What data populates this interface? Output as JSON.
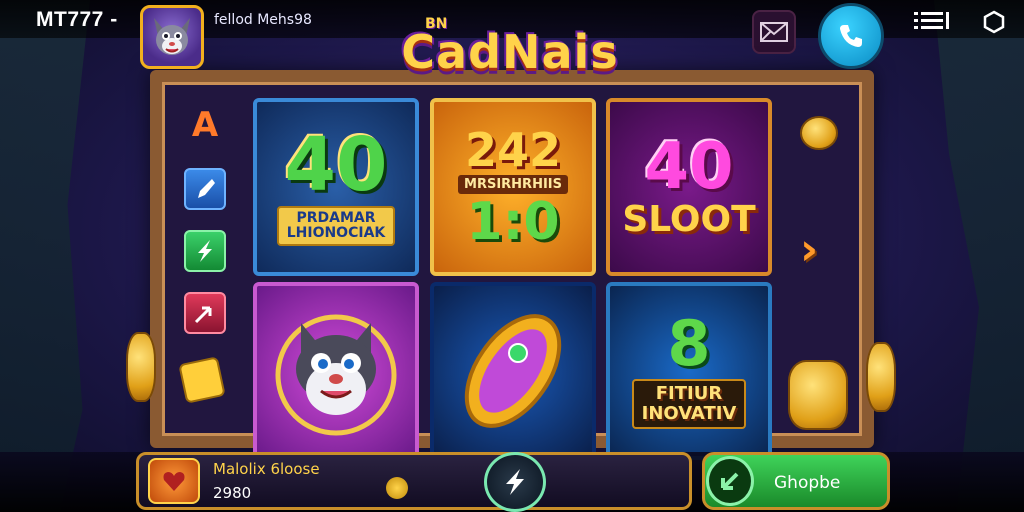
{
  "header": {
    "brand": "MT777 -",
    "subtitle": "fellod Mehs98",
    "mail_icon": "mail-icon",
    "phone_icon": "phone-icon",
    "menu_icon": "menu-icon",
    "settings_icon": "settings-icon"
  },
  "logo": {
    "small": "BN",
    "title": "CadNais"
  },
  "side_left": {
    "letter": "A"
  },
  "reels": {
    "r1": {
      "number": "40",
      "banner_line1": "PRDAMAR",
      "banner_line2": "LHIONOCIAK"
    },
    "r2": {
      "number_a": "242",
      "label": "MRSIRHRHIIS",
      "number_b": "1:0"
    },
    "r3": {
      "number": "40",
      "word": "SLOOT"
    },
    "r6": {
      "number": "8",
      "line1": "FITIUR",
      "line2": "INOVATIV"
    }
  },
  "bottom": {
    "info_title": "Malolix 6loose",
    "info_value": "2980",
    "action_label": "Ghopbe"
  },
  "colors": {
    "accent_gold": "#ffd34a",
    "accent_green": "#3fd35a",
    "accent_blue": "#3bd3ff"
  }
}
